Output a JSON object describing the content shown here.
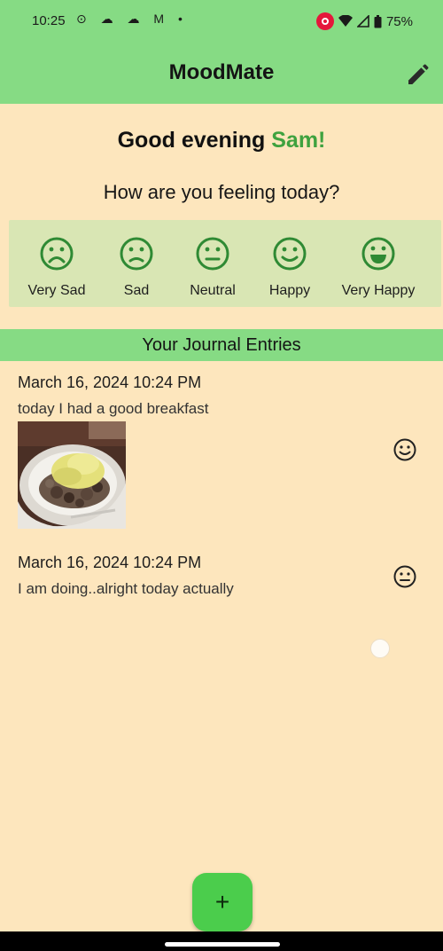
{
  "status_bar": {
    "time": "10:25",
    "left_icons": "⊙ ☁ ☁ M •",
    "battery": "75%"
  },
  "app_bar": {
    "title": "MoodMate",
    "edit_icon": "pencil-icon"
  },
  "greeting": {
    "prefix": "Good evening ",
    "name": "Sam!"
  },
  "question": "How are you feeling today?",
  "moods": [
    {
      "label": "Very Sad",
      "icon": "very-sad-face-icon"
    },
    {
      "label": "Sad",
      "icon": "sad-face-icon"
    },
    {
      "label": "Neutral",
      "icon": "neutral-face-icon"
    },
    {
      "label": "Happy",
      "icon": "happy-face-icon"
    },
    {
      "label": "Very Happy",
      "icon": "very-happy-face-icon"
    }
  ],
  "journal": {
    "header": "Your Journal Entries",
    "entries": [
      {
        "date": "March 16, 2024 10:24 PM",
        "text": "today I had a good breakfast",
        "mood_icon": "happy-face-icon",
        "has_photo": true
      },
      {
        "date": "March 16, 2024 10:24 PM",
        "text": "I am doing..alright today actually",
        "mood_icon": "neutral-face-icon",
        "has_photo": false
      }
    ]
  },
  "fab": {
    "label": "+"
  },
  "colors": {
    "background": "#fde6bd",
    "app_bar": "#86db84",
    "mood_strip": "#d9e6b4",
    "mood_icon": "#2f8a34",
    "accent_name": "#3fa23f",
    "fab": "#4bcd4c"
  }
}
